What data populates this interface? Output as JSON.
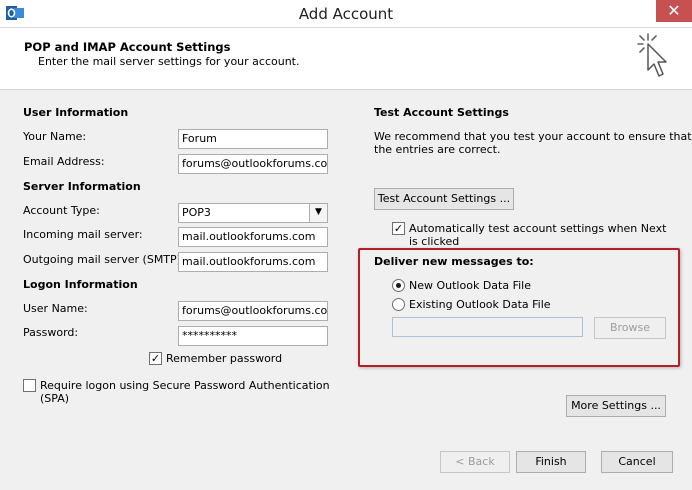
{
  "window": {
    "title": "Add Account",
    "close_glyph": "✕"
  },
  "header": {
    "title": "POP and IMAP Account Settings",
    "subtitle": "Enter the mail server settings for your account."
  },
  "user_info": {
    "heading": "User Information",
    "your_name_label": "Your Name:",
    "your_name_value": "Forum",
    "email_label": "Email Address:",
    "email_value": "forums@outlookforums.com"
  },
  "server_info": {
    "heading": "Server Information",
    "account_type_label": "Account Type:",
    "account_type_value": "POP3",
    "incoming_label": "Incoming mail server:",
    "incoming_value": "mail.outlookforums.com",
    "outgoing_label": "Outgoing mail server (SMTP):",
    "outgoing_value": "mail.outlookforums.com"
  },
  "logon_info": {
    "heading": "Logon Information",
    "username_label": "User Name:",
    "username_value": "forums@outlookforums.com",
    "password_label": "Password:",
    "password_value": "**********",
    "remember_label": "Remember password",
    "remember_checked": true,
    "spa_label_line1": "Require logon using Secure Password Authentication",
    "spa_label_line2": "(SPA)",
    "spa_checked": false
  },
  "test_settings": {
    "heading": "Test Account Settings",
    "desc_line1": "We recommend that you test your account to ensure that",
    "desc_line2": "the entries are correct.",
    "test_button": "Test Account Settings ...",
    "auto_test_line1": "Automatically test account settings when Next",
    "auto_test_line2": "is clicked",
    "auto_test_checked": true
  },
  "deliver": {
    "heading": "Deliver new messages to:",
    "option_new": "New Outlook Data File",
    "option_existing": "Existing Outlook Data File",
    "selected": "New Outlook Data File",
    "file_path_value": "",
    "browse_button": "Browse"
  },
  "more_settings_button": "More Settings ...",
  "footer": {
    "back_button": "< Back",
    "finish_button": "Finish",
    "cancel_button": "Cancel"
  },
  "colors": {
    "highlight_border": "#b21f24",
    "close_button": "#c75050",
    "dialog_background": "#f0f0f0"
  }
}
